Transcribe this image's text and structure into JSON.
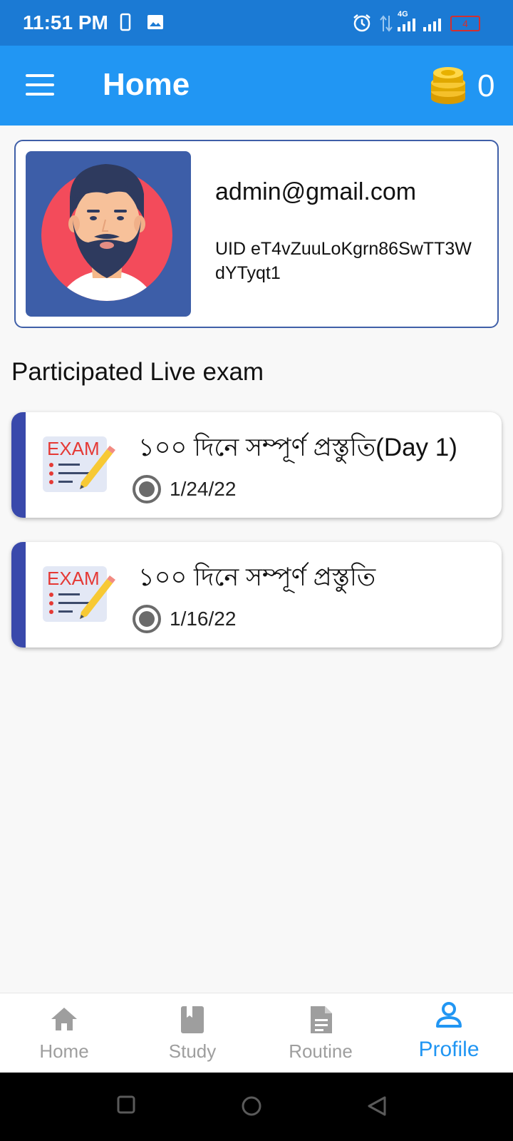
{
  "status_bar": {
    "time": "11:51 PM",
    "network": "4G",
    "battery": "4"
  },
  "app_bar": {
    "title": "Home",
    "coin_count": "0"
  },
  "profile": {
    "email": "admin@gmail.com",
    "uid": "UID eT4vZuuLoKgrn86SwTT3WdYTyqt1"
  },
  "section_title": "Participated Live exam",
  "exams": [
    {
      "title": "১০০ দিনে সম্পূর্ণ প্রস্তুতি(Day 1)",
      "date": "1/24/22",
      "icon_text": "EXAM"
    },
    {
      "title": "১০০ দিনে সম্পূর্ণ প্রস্তুতি",
      "date": "1/16/22",
      "icon_text": "EXAM"
    }
  ],
  "bottom_nav": [
    {
      "label": "Home",
      "icon": "home-icon",
      "active": false
    },
    {
      "label": "Study",
      "icon": "book-icon",
      "active": false
    },
    {
      "label": "Routine",
      "icon": "document-icon",
      "active": false
    },
    {
      "label": "Profile",
      "icon": "person-icon",
      "active": true
    }
  ],
  "colors": {
    "status_bar": "#1b7ad4",
    "app_bar": "#2196f3",
    "accent_bar": "#3949ab",
    "active_nav": "#2196f3"
  }
}
